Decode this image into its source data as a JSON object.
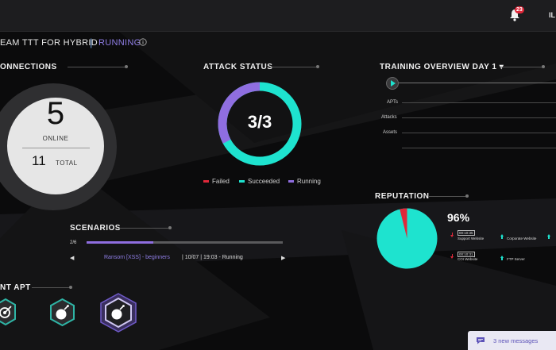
{
  "header": {
    "notification_count": "23",
    "user_initials": "IL"
  },
  "exercise": {
    "title": "EAM TTT FOR HYBRID",
    "separator": "|",
    "status": "RUNNING"
  },
  "connections": {
    "title": "ONNECTIONS",
    "online_value": "5",
    "online_label": "ONLINE",
    "total_value": "11",
    "total_label": "TOTAL"
  },
  "attack_status": {
    "title": "ATTACK STATUS",
    "value": "3/3",
    "legend": [
      {
        "label": "Failed",
        "color": "#e0283a"
      },
      {
        "label": "Succeeded",
        "color": "#1ee3cf"
      },
      {
        "label": "Running",
        "color": "#8f6ee0"
      }
    ]
  },
  "training_overview": {
    "title": "TRAINING OVERVIEW DAY 1 ▾",
    "rows": [
      "APTs",
      "Attacks",
      "Assets"
    ]
  },
  "reputation": {
    "title": "REPUTATION",
    "percent_label": "96%",
    "percent": 96,
    "colors": {
      "good": "#1ee3cf",
      "bad": "#e0283a"
    },
    "sites": [
      {
        "name": "Support Website",
        "time": "00:10:35",
        "trend": "down"
      },
      {
        "name": "Corporate Website",
        "time": "",
        "trend": "up"
      },
      {
        "name": "COI Website",
        "time": "00:10:31",
        "trend": "down"
      },
      {
        "name": "FTP Server",
        "time": "",
        "trend": "up"
      }
    ]
  },
  "scenarios": {
    "title": "SCENARIOS",
    "progress_label": "2/6",
    "progress": 0.34,
    "prev_icon": "chevron-left-icon",
    "next_icon": "chevron-right-icon",
    "name": "Ransom [XSS] - beginners",
    "details": "| 10/07 | 19:03 - Running"
  },
  "apt": {
    "title": "NT APT",
    "icons": [
      "target-icon",
      "bomb-icon",
      "bomb-icon"
    ]
  },
  "chat": {
    "label": "3 new messages",
    "icon": "chat-bubble-icon"
  }
}
